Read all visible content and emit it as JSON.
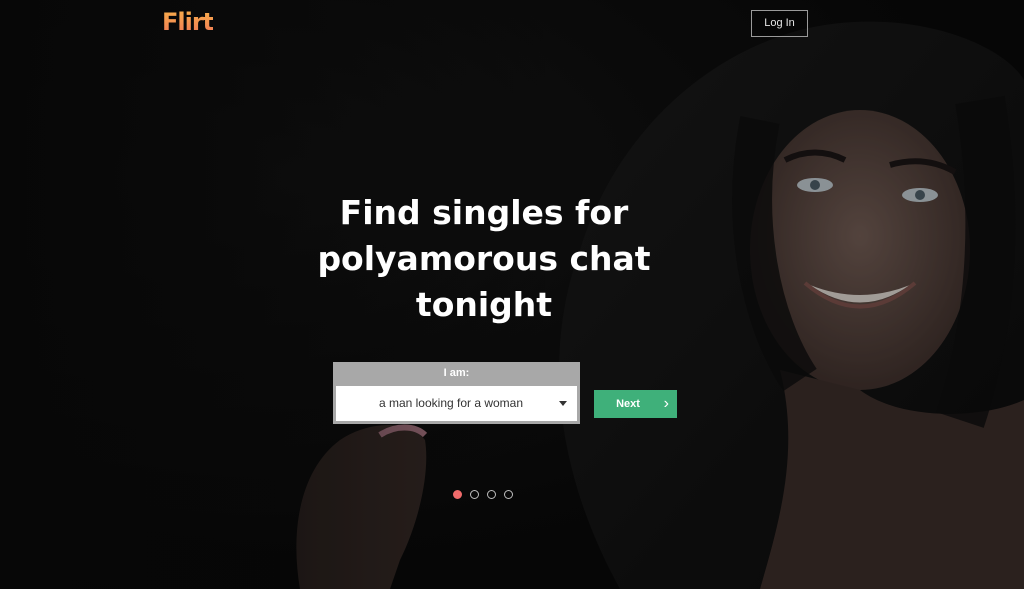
{
  "header": {
    "logo_text": "Flirt",
    "login_label": "Log In"
  },
  "hero": {
    "headline": "Find singles for polyamorous chat tonight"
  },
  "form": {
    "label": "I am:",
    "selected_option": "a man looking for a woman",
    "next_label": "Next"
  },
  "carousel": {
    "slides": 4,
    "active_index": 0
  },
  "colors": {
    "accent_green": "#3fb07a",
    "dot_active": "#f06b6b",
    "logo_orange": "#f7934c"
  }
}
